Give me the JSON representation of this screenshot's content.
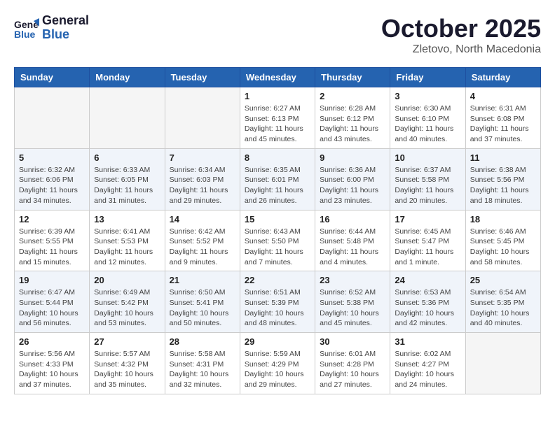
{
  "header": {
    "logo_line1": "General",
    "logo_line2": "Blue",
    "month_title": "October 2025",
    "subtitle": "Zletovo, North Macedonia"
  },
  "days_of_week": [
    "Sunday",
    "Monday",
    "Tuesday",
    "Wednesday",
    "Thursday",
    "Friday",
    "Saturday"
  ],
  "weeks": [
    [
      {
        "day": "",
        "info": ""
      },
      {
        "day": "",
        "info": ""
      },
      {
        "day": "",
        "info": ""
      },
      {
        "day": "1",
        "info": "Sunrise: 6:27 AM\nSunset: 6:13 PM\nDaylight: 11 hours\nand 45 minutes."
      },
      {
        "day": "2",
        "info": "Sunrise: 6:28 AM\nSunset: 6:12 PM\nDaylight: 11 hours\nand 43 minutes."
      },
      {
        "day": "3",
        "info": "Sunrise: 6:30 AM\nSunset: 6:10 PM\nDaylight: 11 hours\nand 40 minutes."
      },
      {
        "day": "4",
        "info": "Sunrise: 6:31 AM\nSunset: 6:08 PM\nDaylight: 11 hours\nand 37 minutes."
      }
    ],
    [
      {
        "day": "5",
        "info": "Sunrise: 6:32 AM\nSunset: 6:06 PM\nDaylight: 11 hours\nand 34 minutes."
      },
      {
        "day": "6",
        "info": "Sunrise: 6:33 AM\nSunset: 6:05 PM\nDaylight: 11 hours\nand 31 minutes."
      },
      {
        "day": "7",
        "info": "Sunrise: 6:34 AM\nSunset: 6:03 PM\nDaylight: 11 hours\nand 29 minutes."
      },
      {
        "day": "8",
        "info": "Sunrise: 6:35 AM\nSunset: 6:01 PM\nDaylight: 11 hours\nand 26 minutes."
      },
      {
        "day": "9",
        "info": "Sunrise: 6:36 AM\nSunset: 6:00 PM\nDaylight: 11 hours\nand 23 minutes."
      },
      {
        "day": "10",
        "info": "Sunrise: 6:37 AM\nSunset: 5:58 PM\nDaylight: 11 hours\nand 20 minutes."
      },
      {
        "day": "11",
        "info": "Sunrise: 6:38 AM\nSunset: 5:56 PM\nDaylight: 11 hours\nand 18 minutes."
      }
    ],
    [
      {
        "day": "12",
        "info": "Sunrise: 6:39 AM\nSunset: 5:55 PM\nDaylight: 11 hours\nand 15 minutes."
      },
      {
        "day": "13",
        "info": "Sunrise: 6:41 AM\nSunset: 5:53 PM\nDaylight: 11 hours\nand 12 minutes."
      },
      {
        "day": "14",
        "info": "Sunrise: 6:42 AM\nSunset: 5:52 PM\nDaylight: 11 hours\nand 9 minutes."
      },
      {
        "day": "15",
        "info": "Sunrise: 6:43 AM\nSunset: 5:50 PM\nDaylight: 11 hours\nand 7 minutes."
      },
      {
        "day": "16",
        "info": "Sunrise: 6:44 AM\nSunset: 5:48 PM\nDaylight: 11 hours\nand 4 minutes."
      },
      {
        "day": "17",
        "info": "Sunrise: 6:45 AM\nSunset: 5:47 PM\nDaylight: 11 hours\nand 1 minute."
      },
      {
        "day": "18",
        "info": "Sunrise: 6:46 AM\nSunset: 5:45 PM\nDaylight: 10 hours\nand 58 minutes."
      }
    ],
    [
      {
        "day": "19",
        "info": "Sunrise: 6:47 AM\nSunset: 5:44 PM\nDaylight: 10 hours\nand 56 minutes."
      },
      {
        "day": "20",
        "info": "Sunrise: 6:49 AM\nSunset: 5:42 PM\nDaylight: 10 hours\nand 53 minutes."
      },
      {
        "day": "21",
        "info": "Sunrise: 6:50 AM\nSunset: 5:41 PM\nDaylight: 10 hours\nand 50 minutes."
      },
      {
        "day": "22",
        "info": "Sunrise: 6:51 AM\nSunset: 5:39 PM\nDaylight: 10 hours\nand 48 minutes."
      },
      {
        "day": "23",
        "info": "Sunrise: 6:52 AM\nSunset: 5:38 PM\nDaylight: 10 hours\nand 45 minutes."
      },
      {
        "day": "24",
        "info": "Sunrise: 6:53 AM\nSunset: 5:36 PM\nDaylight: 10 hours\nand 42 minutes."
      },
      {
        "day": "25",
        "info": "Sunrise: 6:54 AM\nSunset: 5:35 PM\nDaylight: 10 hours\nand 40 minutes."
      }
    ],
    [
      {
        "day": "26",
        "info": "Sunrise: 5:56 AM\nSunset: 4:33 PM\nDaylight: 10 hours\nand 37 minutes."
      },
      {
        "day": "27",
        "info": "Sunrise: 5:57 AM\nSunset: 4:32 PM\nDaylight: 10 hours\nand 35 minutes."
      },
      {
        "day": "28",
        "info": "Sunrise: 5:58 AM\nSunset: 4:31 PM\nDaylight: 10 hours\nand 32 minutes."
      },
      {
        "day": "29",
        "info": "Sunrise: 5:59 AM\nSunset: 4:29 PM\nDaylight: 10 hours\nand 29 minutes."
      },
      {
        "day": "30",
        "info": "Sunrise: 6:01 AM\nSunset: 4:28 PM\nDaylight: 10 hours\nand 27 minutes."
      },
      {
        "day": "31",
        "info": "Sunrise: 6:02 AM\nSunset: 4:27 PM\nDaylight: 10 hours\nand 24 minutes."
      },
      {
        "day": "",
        "info": ""
      }
    ]
  ]
}
